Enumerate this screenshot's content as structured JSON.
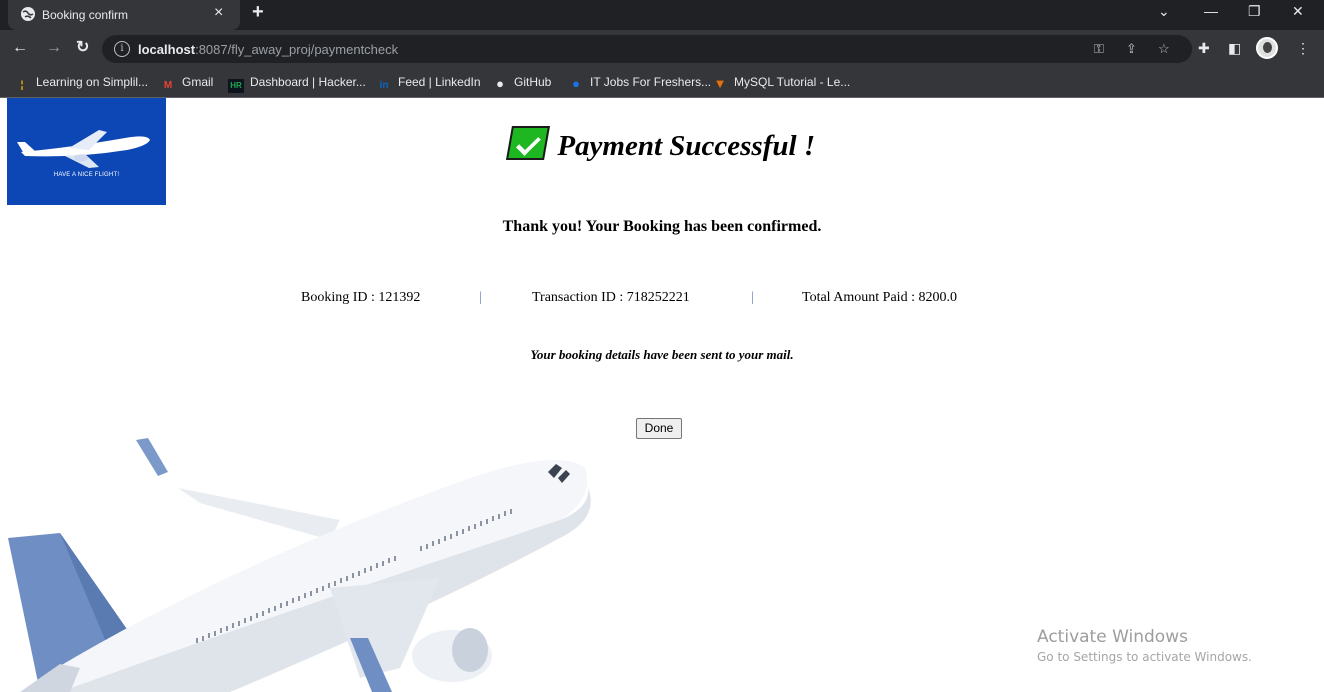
{
  "browser": {
    "tab_title": "Booking confirm",
    "tab_close": "×",
    "new_tab": "+",
    "url_host": "localhost",
    "url_path": ":8087/fly_away_proj/paymentcheck",
    "bookmarks": [
      {
        "label": "Learning on Simplil...",
        "icon": "simplilearn-icon",
        "color": "#f4b400"
      },
      {
        "label": "Gmail",
        "icon": "gmail-icon",
        "color": "#ea4335"
      },
      {
        "label": "Dashboard | Hacker...",
        "icon": "hackerrank-icon",
        "color": "#1ba94c"
      },
      {
        "label": "Feed | LinkedIn",
        "icon": "linkedin-icon",
        "color": "#0a66c2"
      },
      {
        "label": "GitHub",
        "icon": "github-icon",
        "color": "#e8eaed"
      },
      {
        "label": "IT Jobs For Freshers...",
        "icon": "jobs-icon",
        "color": "#1a73e8"
      },
      {
        "label": "MySQL Tutorial - Le...",
        "icon": "mysql-icon",
        "color": "#e8710a"
      }
    ]
  },
  "page": {
    "logo_tagline": "HAVE A NICE FLIGHT!",
    "heading": "Payment Successful !",
    "thanks": "Thank you! Your Booking has been confirmed.",
    "booking_id": "Booking ID : 121392",
    "separator": "|",
    "transaction_id": "Transaction ID : 718252221",
    "amount_paid": "Total Amount Paid : 8200.0",
    "mail_note": "Your booking details have been sent to your mail.",
    "done_label": "Done"
  },
  "watermark": {
    "line1": "Activate Windows",
    "line2": "Go to Settings to activate Windows."
  },
  "colors": {
    "logo_bg": "#0d47b5",
    "success_green": "#1eb722",
    "chrome_dark": "#202124",
    "chrome_mid": "#35363a"
  }
}
